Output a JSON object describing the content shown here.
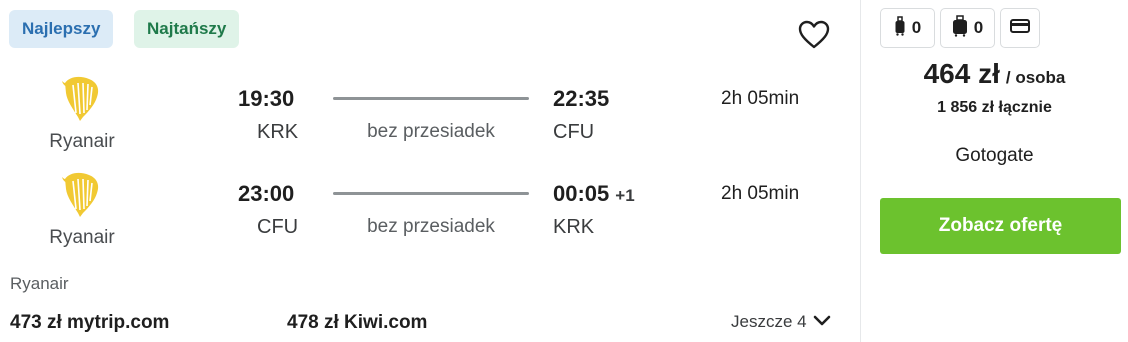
{
  "badges": {
    "best": "Najlepszy",
    "cheapest": "Najtańszy"
  },
  "outbound": {
    "airline": "Ryanair",
    "depart_time": "19:30",
    "depart_code": "KRK",
    "stops": "bez przesiadek",
    "arrive_time": "22:35",
    "arrive_code": "CFU",
    "arrive_plus_day": "",
    "duration": "2h 05min"
  },
  "inbound": {
    "airline": "Ryanair",
    "depart_time": "23:00",
    "depart_code": "CFU",
    "stops": "bez przesiadek",
    "arrive_time": "00:05",
    "arrive_code": "KRK",
    "arrive_plus_day": "+1",
    "duration": "2h 05min"
  },
  "footer": {
    "operating_airline": "Ryanair",
    "offer1": "473 zł mytrip.com",
    "offer2": "478 zł Kiwi.com",
    "more_label": "Jeszcze 4"
  },
  "side": {
    "bags": [
      {
        "icon": "cabin-bag-icon",
        "count": "0"
      },
      {
        "icon": "checked-bag-icon",
        "count": "0"
      },
      {
        "icon": "card-icon",
        "count": ""
      }
    ],
    "price": "464 zł",
    "per_person": "/ osoba",
    "total": "1 856 zł łącznie",
    "provider": "Gotogate",
    "cta_label": "Zobacz ofertę"
  },
  "colors": {
    "cta": "#6cc22e",
    "badge_best_bg": "#dcebf7",
    "badge_cheap_bg": "#dff3e8",
    "ryanair_logo": "#f1c933"
  }
}
